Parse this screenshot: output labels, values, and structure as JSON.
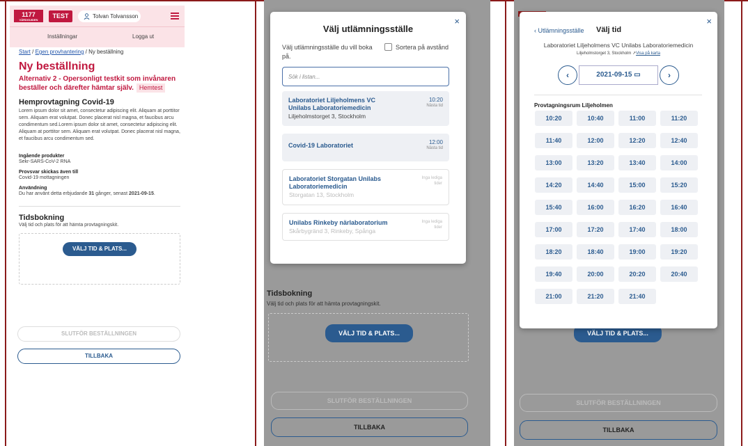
{
  "panel1": {
    "logo": "1177",
    "logo_sub": "VÅRDGUIDEN",
    "test_badge": "TEST",
    "user_name": "Tolvan Tolvansson",
    "nav": {
      "settings": "Inställningar",
      "logout": "Logga ut"
    },
    "breadcrumb": {
      "start": "Start",
      "sep1": " / ",
      "egen": "Egen provhantering",
      "sep2": " / ",
      "current": "Ny beställning"
    },
    "title": "Ny beställning",
    "subtitle": "Alternativ 2 - Opersonligt testkit som invånaren beställer och därefter hämtar själv.",
    "tag": "Hemtest",
    "product_title": "Hemprovtagning Covid-19",
    "lorem": "Lorem ipsum dolor sit amet, consectetur adipiscing elit. Aliquam at porttitor sem. Aliquam erat volutpat. Donec placerat nisl magna, et faucibus arcu condimentum sed.Lorem ipsum dolor sit amet, consectetur adipiscing elit. Aliquam at porttitor sem. Aliquam erat volutpat. Donec placerat nisl magna, et faucibus arcu condimentum sed.",
    "included_label": "Ingående produkter",
    "included_value": "Sekr-SARS-CoV-2 RNA",
    "answers_label": "Provsvar skickas även till",
    "answers_value": "Covid-19 mottagningen",
    "usage_label": "Användning",
    "usage_pre": "Du har använt detta erbjudande ",
    "usage_count": "31",
    "usage_mid": " gånger, senast ",
    "usage_date": "2021-09-15",
    "usage_end": ".",
    "booking_title": "Tidsbokning",
    "booking_sub": "Välj tid och plats för att hämta provtagningskit.",
    "choose_btn": "VÄLJ TID & PLATS...",
    "finish_btn": "SLUTFÖR BESTÄLLNINGEN",
    "back_btn": "TILLBAKA"
  },
  "panel2": {
    "modal_title": "Välj utlämningsställe",
    "close": "×",
    "description": "Välj utlämningsställe du vill boka på.",
    "sort_label": "Sortera på avstånd",
    "search_placeholder": "Sök i listan...",
    "locations": [
      {
        "name": "Laboratoriet Liljeholmens VC Unilabs Laboratoriemedicin",
        "address": "Liljeholmstorget 3, Stockholm",
        "time": "10:20",
        "time_sub": "Nästa tid"
      },
      {
        "name": "Covid-19 Laboratoriet",
        "address": "",
        "time": "12:00",
        "time_sub": "Nästa tid"
      },
      {
        "name": "Laboratoriet Storgatan Unilabs Laboratoriemedicin",
        "address": "Storgatan 13, Stockholm",
        "time": "Inga lediga tider",
        "time_sub": ""
      },
      {
        "name": "Unilabs Rinkeby närlaboratorium",
        "address": "Skårbygränd 3, Rinkeby, Spånga",
        "time": "Inga lediga tider",
        "time_sub": ""
      }
    ],
    "bg_title": "Tidsbokning",
    "bg_sub": "Välj tid och plats för att hämta provtagningskit.",
    "bg_choose": "VÄLJ TID & PLATS...",
    "bg_finish": "SLUTFÖR BESTÄLLNINGEN",
    "bg_back": "TILLBAKA"
  },
  "panel3": {
    "back_link": "Utlämningsställe",
    "title": "Välj tid",
    "close": "×",
    "location": "Laboratoriet Liljeholmens VC Unilabs Laboratoriemedicin",
    "address": "Liljeholmstorget 3, Stockholm",
    "map_link": "Visa på karta",
    "date": "2021-09-15",
    "room_title": "Provtagningsrum Liljeholmen",
    "slots": [
      "10:20",
      "10:40",
      "11:00",
      "11:20",
      "11:40",
      "12:00",
      "12:20",
      "12:40",
      "13:00",
      "13:20",
      "13:40",
      "14:00",
      "14:20",
      "14:40",
      "15:00",
      "15:20",
      "15:40",
      "16:00",
      "16:20",
      "16:40",
      "17:00",
      "17:20",
      "17:40",
      "18:00",
      "18:20",
      "18:40",
      "19:00",
      "19:20",
      "19:40",
      "20:00",
      "20:20",
      "20:40",
      "21:00",
      "21:20",
      "21:40"
    ],
    "bg_choose": "VÄLJ TID & PLATS...",
    "bg_finish": "SLUTFÖR BESTÄLLNINGEN",
    "bg_back": "TILLBAKA"
  },
  "colors": {
    "brand": "#c0183f",
    "primary": "#2b5b8f",
    "divider": "#8b1a1a"
  }
}
